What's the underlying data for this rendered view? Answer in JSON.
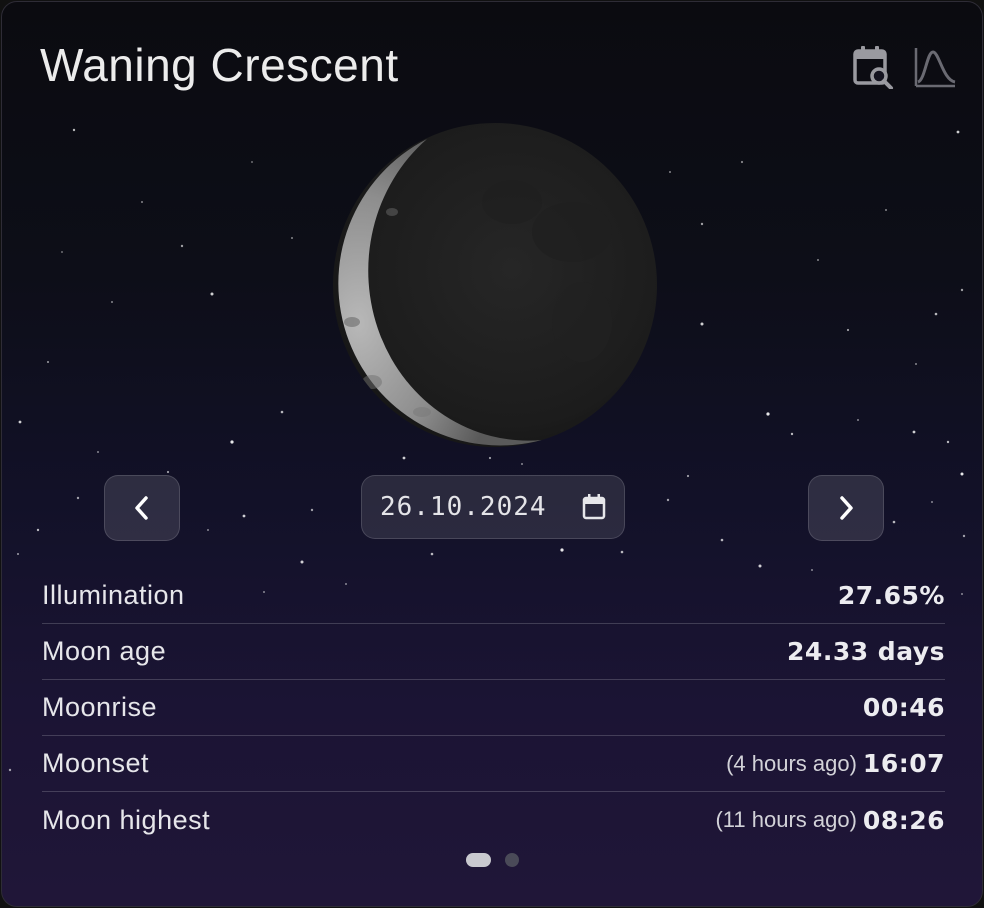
{
  "card": {
    "phase_title": "Waning Crescent",
    "icons": {
      "calendar": "calendar-search-icon",
      "chart": "moon-chart-icon"
    }
  },
  "moon": {
    "phase": "waning-crescent",
    "illumination_fraction": 0.2765
  },
  "date_picker": {
    "value": "26.10.2024",
    "prev_icon": "chevron-left-icon",
    "next_icon": "chevron-right-icon",
    "calendar_icon": "calendar-icon"
  },
  "rows": [
    {
      "label": "Illumination",
      "note": "",
      "value": "27.65%"
    },
    {
      "label": "Moon age",
      "note": "",
      "value": "24.33 days"
    },
    {
      "label": "Moonrise",
      "note": "",
      "value": "00:46"
    },
    {
      "label": "Moonset",
      "note": "(4 hours ago)",
      "value": "16:07"
    },
    {
      "label": "Moon highest",
      "note": "(11 hours ago)",
      "value": "08:26"
    }
  ],
  "pagination": {
    "pages": 2,
    "active": 1
  },
  "colors": {
    "background_top": "#0b0b10",
    "background_bottom": "#201638",
    "text": "#ececec"
  }
}
